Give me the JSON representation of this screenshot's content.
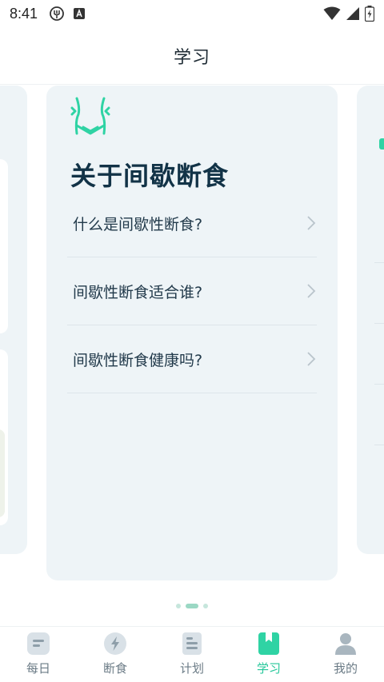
{
  "status_bar": {
    "time": "8:41"
  },
  "header": {
    "title": "学习"
  },
  "main_card": {
    "title": "关于间歇断食",
    "items": [
      {
        "label": "什么是间歇性断食?"
      },
      {
        "label": "间歇性断食适合谁?"
      },
      {
        "label": "间歇性断食健康吗?"
      }
    ]
  },
  "pager": {
    "count": 3,
    "active_index": 1
  },
  "bottom_nav": {
    "items": [
      {
        "label": "每日",
        "icon": "daily-icon"
      },
      {
        "label": "断食",
        "icon": "fasting-icon"
      },
      {
        "label": "计划",
        "icon": "plan-icon"
      },
      {
        "label": "学习",
        "icon": "bookmark-icon"
      },
      {
        "label": "我的",
        "icon": "profile-icon"
      }
    ],
    "active_index": 3
  },
  "colors": {
    "accent": "#2fd3a4",
    "card_bg": "#eef4f7",
    "title_text": "#123347"
  }
}
